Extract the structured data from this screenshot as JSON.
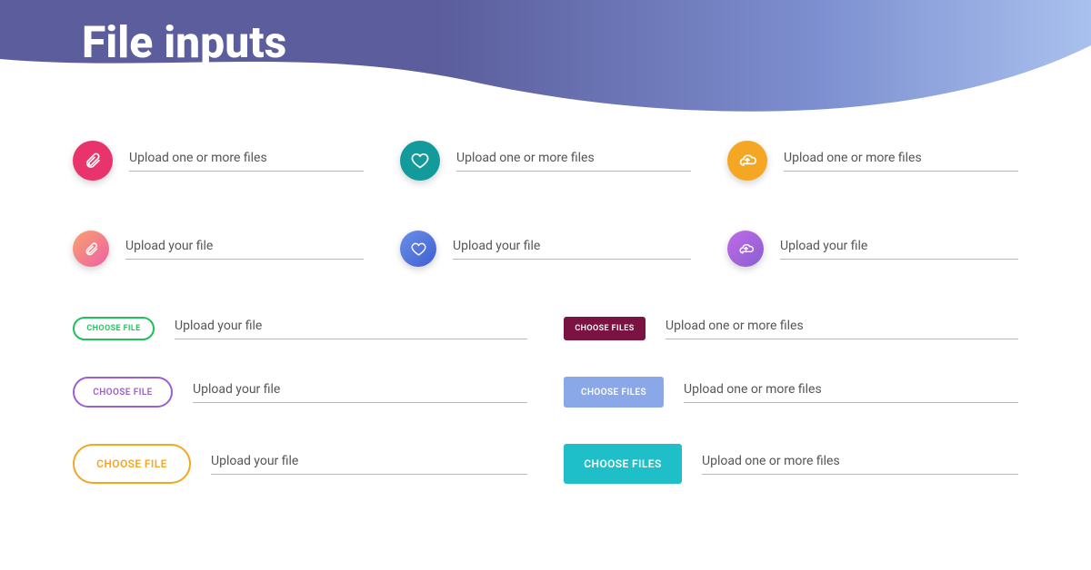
{
  "page": {
    "title": "File inputs"
  },
  "row1": {
    "a": {
      "placeholder": "Upload one or more files"
    },
    "b": {
      "placeholder": "Upload one or more files"
    },
    "c": {
      "placeholder": "Upload one or more files"
    }
  },
  "row2": {
    "a": {
      "placeholder": "Upload your file"
    },
    "b": {
      "placeholder": "Upload your file"
    },
    "c": {
      "placeholder": "Upload your file"
    }
  },
  "buttons": {
    "left": {
      "sm": {
        "label": "Choose file",
        "placeholder": "Upload your file"
      },
      "md": {
        "label": "Choose file",
        "placeholder": "Upload your file"
      },
      "lg": {
        "label": "Choose file",
        "placeholder": "Upload your file"
      }
    },
    "right": {
      "sm": {
        "label": "Choose files",
        "placeholder": "Upload one or more files"
      },
      "md": {
        "label": "Choose files",
        "placeholder": "Upload one or more files"
      },
      "lg": {
        "label": "Choose files",
        "placeholder": "Upload one or more files"
      }
    }
  },
  "colors": {
    "pink": "#e8336d",
    "teal": "#139b9b",
    "amber": "#f5a623",
    "green": "#1fbf5a",
    "purple": "#9b5fd1",
    "orange": "#f5a623",
    "maroon": "#7a1342",
    "blue": "#8aa8e8",
    "cyan": "#1fbfc9"
  }
}
